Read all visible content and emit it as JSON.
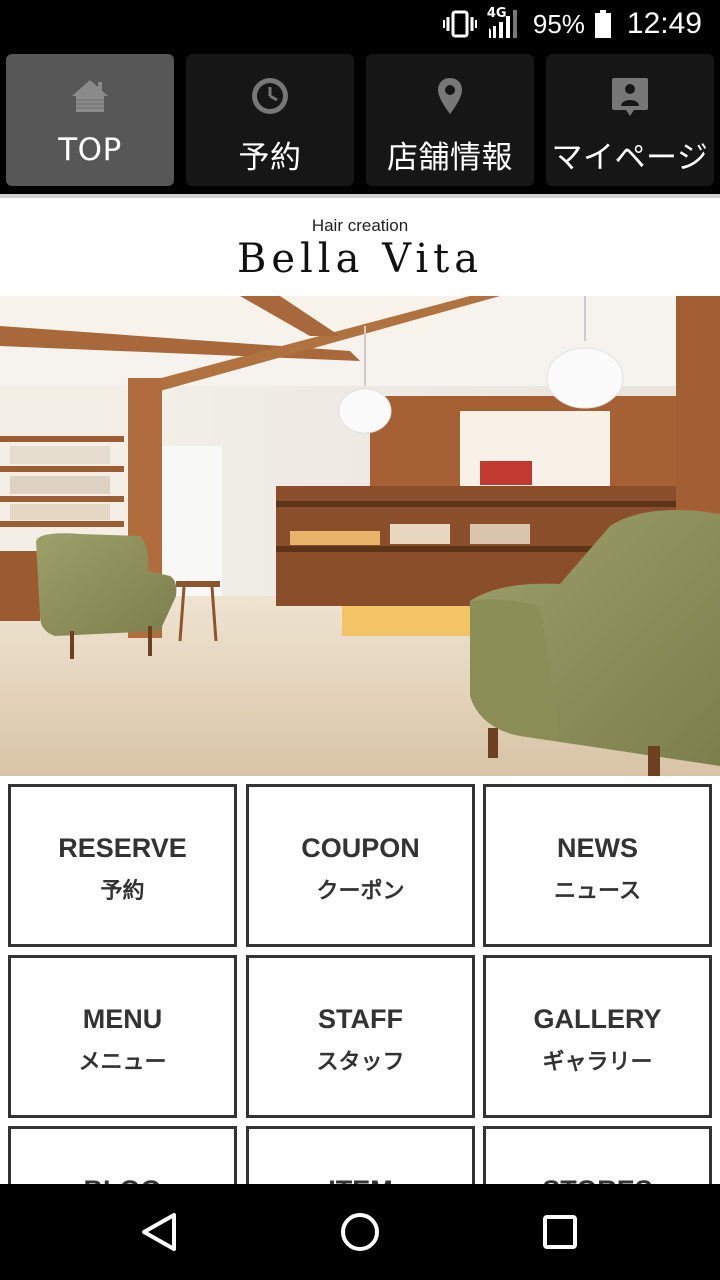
{
  "status_bar": {
    "network": "4G",
    "battery_percent": "95%",
    "time": "12:49"
  },
  "nav": {
    "items": [
      {
        "label": "TOP",
        "icon": "home-icon",
        "active": true
      },
      {
        "label": "予約",
        "icon": "clock-icon",
        "active": false
      },
      {
        "label": "店舗情報",
        "icon": "map-pin-icon",
        "active": false
      },
      {
        "label": "マイページ",
        "icon": "id-card-icon",
        "active": false
      }
    ]
  },
  "brand": {
    "subtitle": "Hair creation",
    "name": "Bella Vita"
  },
  "hero": {
    "icon": "salon-interior-photo"
  },
  "menu": {
    "tiles": [
      {
        "en": "RESERVE",
        "jp": "予約"
      },
      {
        "en": "COUPON",
        "jp": "クーポン"
      },
      {
        "en": "NEWS",
        "jp": "ニュース"
      },
      {
        "en": "MENU",
        "jp": "メニュー"
      },
      {
        "en": "STAFF",
        "jp": "スタッフ"
      },
      {
        "en": "GALLERY",
        "jp": "ギャラリー"
      },
      {
        "en": "BLOG",
        "jp": ""
      },
      {
        "en": "ITEM",
        "jp": ""
      },
      {
        "en": "STORES",
        "jp": ""
      }
    ]
  },
  "system_nav": {
    "back_icon": "back-triangle-icon",
    "home_icon": "home-circle-icon",
    "recents_icon": "recents-square-icon"
  },
  "colors": {
    "nav_active": "#575757",
    "nav_inactive": "#161616",
    "tile_border": "#333333"
  }
}
